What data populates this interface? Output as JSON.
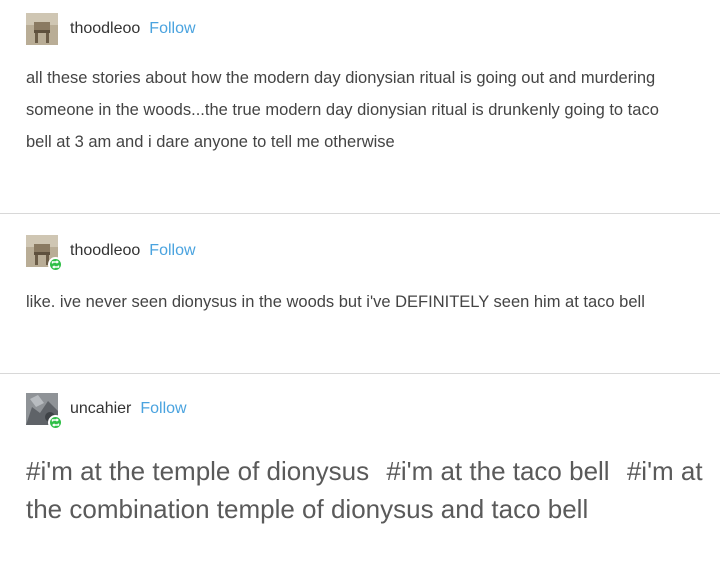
{
  "posts": [
    {
      "username": "thoodleoo",
      "follow_label": "Follow",
      "avatar_icon": "chair-photo-avatar",
      "text": "all these stories about how the modern day dionysian ritual is going out and murdering someone in the woods...the true modern day dionysian ritual is drunkenly going to taco bell at 3 am and i dare anyone to tell me otherwise"
    },
    {
      "username": "thoodleoo",
      "follow_label": "Follow",
      "avatar_icon": "chair-photo-avatar",
      "badge_icon": "reblog-icon",
      "text": "like. ive never seen dionysus in the woods but i've DEFINITELY seen him at taco bell"
    },
    {
      "username": "uncahier",
      "follow_label": "Follow",
      "avatar_icon": "gray-photo-avatar",
      "badge_icon": "reblog-icon",
      "tags": [
        "#i'm at the temple of dionysus",
        "#i'm at the taco bell",
        "#i'm at the combination temple of dionysus and taco bell"
      ]
    }
  ],
  "colors": {
    "follow": "#4aa3df",
    "badge": "#2fbf47",
    "text": "#444444",
    "divider": "#d8d8d8"
  }
}
